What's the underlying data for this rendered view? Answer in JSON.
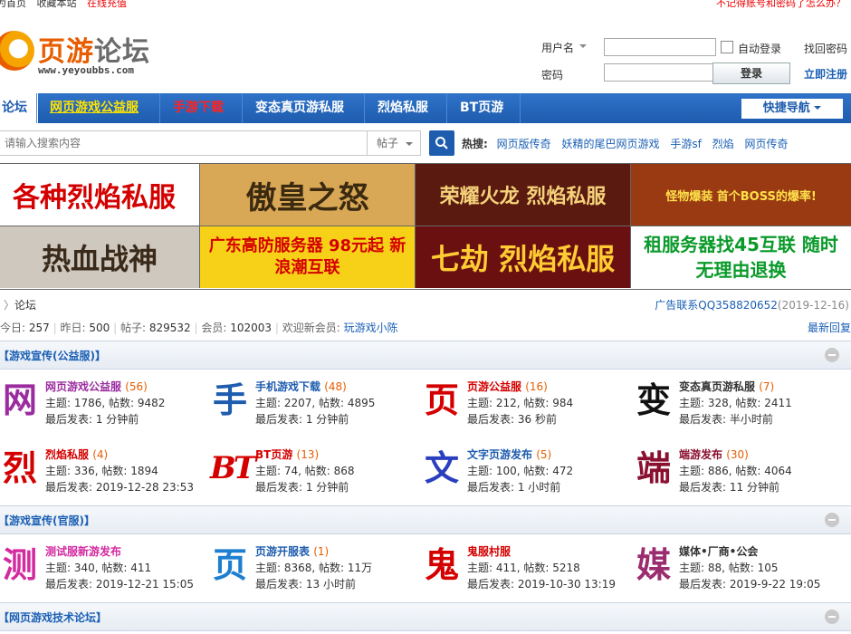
{
  "topbar": {
    "links": [
      "为首页",
      "收藏本站",
      "在线充值"
    ],
    "forgot": "不记得账号和密码了怎么办？"
  },
  "logo": {
    "brand_a": "页游",
    "brand_b": "论坛",
    "url": "www.yeyoubbs.com"
  },
  "login": {
    "username_label": "用户名",
    "password_label": "密码",
    "auto_login": "自动登录",
    "find_password": "找回密码",
    "login_button": "登录",
    "register": "立即注册"
  },
  "nav": {
    "items": [
      "论坛",
      "网页游戏公益服",
      "手游下载",
      "变态真页游私服",
      "烈焰私服",
      "BT页游"
    ],
    "quick": "快捷导航"
  },
  "search": {
    "placeholder": "请输入搜索内容",
    "scope": "帖子",
    "hot_label": "热搜:",
    "hot": [
      "网页版传奇",
      "妖精的尾巴网页游戏",
      "手游sf",
      "烈焰",
      "网页传奇"
    ]
  },
  "banners": [
    {
      "text": "各种烈焰私服",
      "fg": "#d40000",
      "bg": "#ffffff"
    },
    {
      "text": "傲皇之怒",
      "fg": "#3b2a10",
      "bg": "#d9a856"
    },
    {
      "text": "荣耀火龙 烈焰私服",
      "fg": "#f5d27a",
      "bg": "#5a1a10"
    },
    {
      "text": "怪物爆装 首个BOSS的爆率!",
      "fg": "#ffe14a",
      "bg": "#9a3a12"
    },
    {
      "text": "热血战神",
      "fg": "#3a2a1a",
      "bg": "#cfc8bf"
    },
    {
      "text": "广东高防服务器 98元起 新浪潮互联",
      "fg": "#d40000",
      "bg": "#f7d117"
    },
    {
      "text": "七劫 烈焰私服",
      "fg": "#ffcc33",
      "bg": "#6b1010"
    },
    {
      "text": "租服务器找45互联 随时无理由退换",
      "fg": "#0a9a2a",
      "bg": "#ffffff"
    }
  ],
  "breadcrumb": {
    "title": "论坛",
    "ad": "广告联系QQ358820652",
    "date": "(2019-12-16)"
  },
  "stats": {
    "today_label": "今日:",
    "today": "257",
    "yesterday_label": "昨日:",
    "yesterday": "500",
    "posts_label": "帖子:",
    "posts": "829532",
    "members_label": "会员:",
    "members": "102003",
    "welcome": "欢迎新会员:",
    "new_user": "玩游戏小陈",
    "new_reply": "最新回复"
  },
  "sections": [
    {
      "title": "【游戏宣传(公益服)】",
      "forums": [
        {
          "icon": "网",
          "icon_color": "#9b2c9f",
          "name": "网页游戏公益服",
          "count": "(56)",
          "name_color": "#9b2c9f",
          "l2": "主题: 1786, 帖数: 9482",
          "l3": "最后发表: 1 分钟前"
        },
        {
          "icon": "手",
          "icon_color": "#1e5cae",
          "name": "手机游戏下载",
          "count": "(48)",
          "name_color": "#1e5cae",
          "l2": "主题: 2207, 帖数: 4895",
          "l3": "最后发表: 1 分钟前"
        },
        {
          "icon": "页",
          "icon_color": "#d40000",
          "name": "页游公益服",
          "count": "(16)",
          "name_color": "#d40000",
          "l2": "主题: 212, 帖数: 984",
          "l3": "最后发表: 36 秒前"
        },
        {
          "icon": "变",
          "icon_color": "#111111",
          "name": "变态真页游私服",
          "count": "(7)",
          "name_color": "#333333",
          "l2": "主题: 328, 帖数: 2411",
          "l3": "最后发表: 半小时前"
        },
        {
          "icon": "烈",
          "icon_color": "#d40000",
          "name": "烈焰私服",
          "count": "(4)",
          "name_color": "#d40000",
          "l2": "主题: 336, 帖数: 1894",
          "l3": "最后发表: 2019-12-28 23:53"
        },
        {
          "icon": "BT",
          "icon_color": "#d40000",
          "name": "BT页游",
          "count": "(13)",
          "name_color": "#d40000",
          "l2": "主题: 74, 帖数: 868",
          "l3": "最后发表: 1 分钟前"
        },
        {
          "icon": "文",
          "icon_color": "#2a3fbf",
          "name": "文字页游发布",
          "count": "(5)",
          "name_color": "#1e5cae",
          "l2": "主题: 100, 帖数: 472",
          "l3": "最后发表: 1 小时前"
        },
        {
          "icon": "端",
          "icon_color": "#8a1030",
          "name": "端游发布",
          "count": "(30)",
          "name_color": "#8a1030",
          "l2": "主题: 886, 帖数: 4064",
          "l3": "最后发表: 11 分钟前"
        }
      ]
    },
    {
      "title": "【游戏宣传(官服)】",
      "forums": [
        {
          "icon": "测",
          "icon_color": "#d42aa0",
          "name": "测试服新游发布",
          "count": "",
          "name_color": "#d42aa0",
          "l2": "主题: 340, 帖数: 411",
          "l3": "最后发表: 2019-12-21 15:05"
        },
        {
          "icon": "页",
          "icon_color": "#1e7fd0",
          "name": "页游开服表",
          "count": "(1)",
          "name_color": "#1e5cae",
          "l2": "主题: 8368, 帖数: 11万",
          "l3": "最后发表: 13 小时前"
        },
        {
          "icon": "鬼",
          "icon_color": "#d40000",
          "name": "鬼服村服",
          "count": "",
          "name_color": "#d40000",
          "l2": "主题: 411, 帖数: 5218",
          "l3": "最后发表: 2019-10-30 13:19"
        },
        {
          "icon": "媒",
          "icon_color": "#9b2c6f",
          "name": "媒体•厂商•公会",
          "count": "",
          "name_color": "#333333",
          "l2": "主题: 88, 帖数: 105",
          "l3": "最后发表: 2019-9-22 19:05"
        }
      ]
    },
    {
      "title": "【网页游戏技术论坛】",
      "forums": []
    }
  ]
}
